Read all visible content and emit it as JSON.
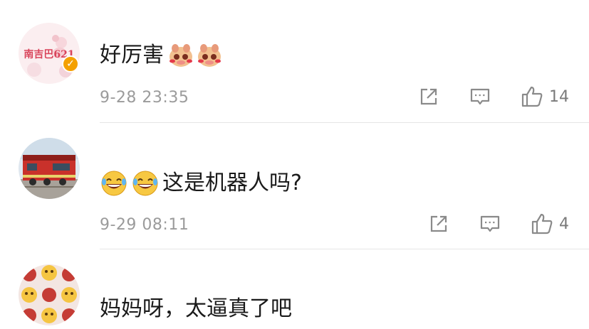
{
  "comments": [
    {
      "avatar_text": "南吉巴621",
      "avatar_icon": "girl-illustration-avatar",
      "verified": true,
      "verified_icon": "verified-badge-icon",
      "text": "好厉害",
      "emojis": [
        "shy-pig-sticker",
        "shy-pig-sticker"
      ],
      "time": "9-28 23:35",
      "like_count": "14"
    },
    {
      "avatar_icon": "locomotive-photo-avatar",
      "verified": false,
      "emojis_before": [
        "laughing-tears-emoji",
        "laughing-tears-emoji"
      ],
      "text": "这是机器人吗?",
      "time": "9-29 08:11",
      "like_count": "4"
    },
    {
      "avatar_icon": "emoji-collage-avatar",
      "verified": false,
      "text": "妈妈呀，太逼真了吧"
    }
  ],
  "icons": {
    "share": "share-icon",
    "comment": "comment-icon",
    "like": "thumbs-up-icon"
  },
  "colors": {
    "timestamp": "#9b9b9b",
    "icon": "#8a8a8a",
    "verified": "#f4a000",
    "divider": "#e6e6e6"
  }
}
